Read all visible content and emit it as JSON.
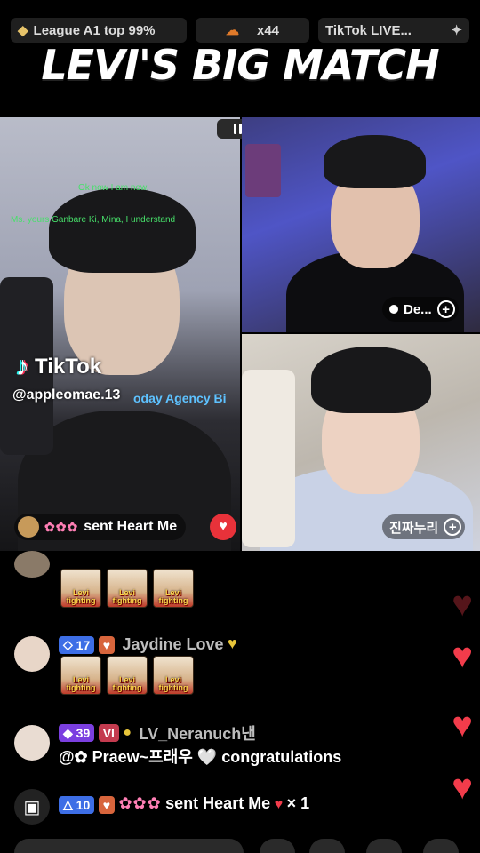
{
  "top_pills": {
    "league": "League A1 top 99%",
    "multiplier": "x44",
    "tiktok_live": "TikTok LIVE..."
  },
  "overlay_title": "LEVI'S BIG MATCH",
  "left_cam": {
    "green_line1": "Ok now I am now.",
    "green_line2": "Ms. yours Ganbare Ki, Mina, I understand",
    "tiktok_logo": "TikTok",
    "tiktok_handle": "@appleomae.13",
    "agency_text": "oday Agency Bi",
    "sent_text": "sent Heart Me"
  },
  "right_top_cam": {
    "name": "De..."
  },
  "right_bottom_cam": {
    "name": "진짜누리"
  },
  "chat": {
    "sticker_text": "Levi fighting",
    "msg1": {
      "level": "17",
      "name": "Jaydine Love"
    },
    "msg2": {
      "level": "39",
      "name": "LV_Neranuch낸",
      "text": "@✿ Praew~프래우 🤍 congratulations"
    },
    "msg3": {
      "level": "10",
      "text": "sent Heart Me",
      "count": "× 1"
    }
  },
  "colors": {
    "heart": "#f23c4b",
    "tiktok_green": "#47e06a",
    "level_blue": "#3d6ee6",
    "level_purple": "#7b3fe0"
  }
}
